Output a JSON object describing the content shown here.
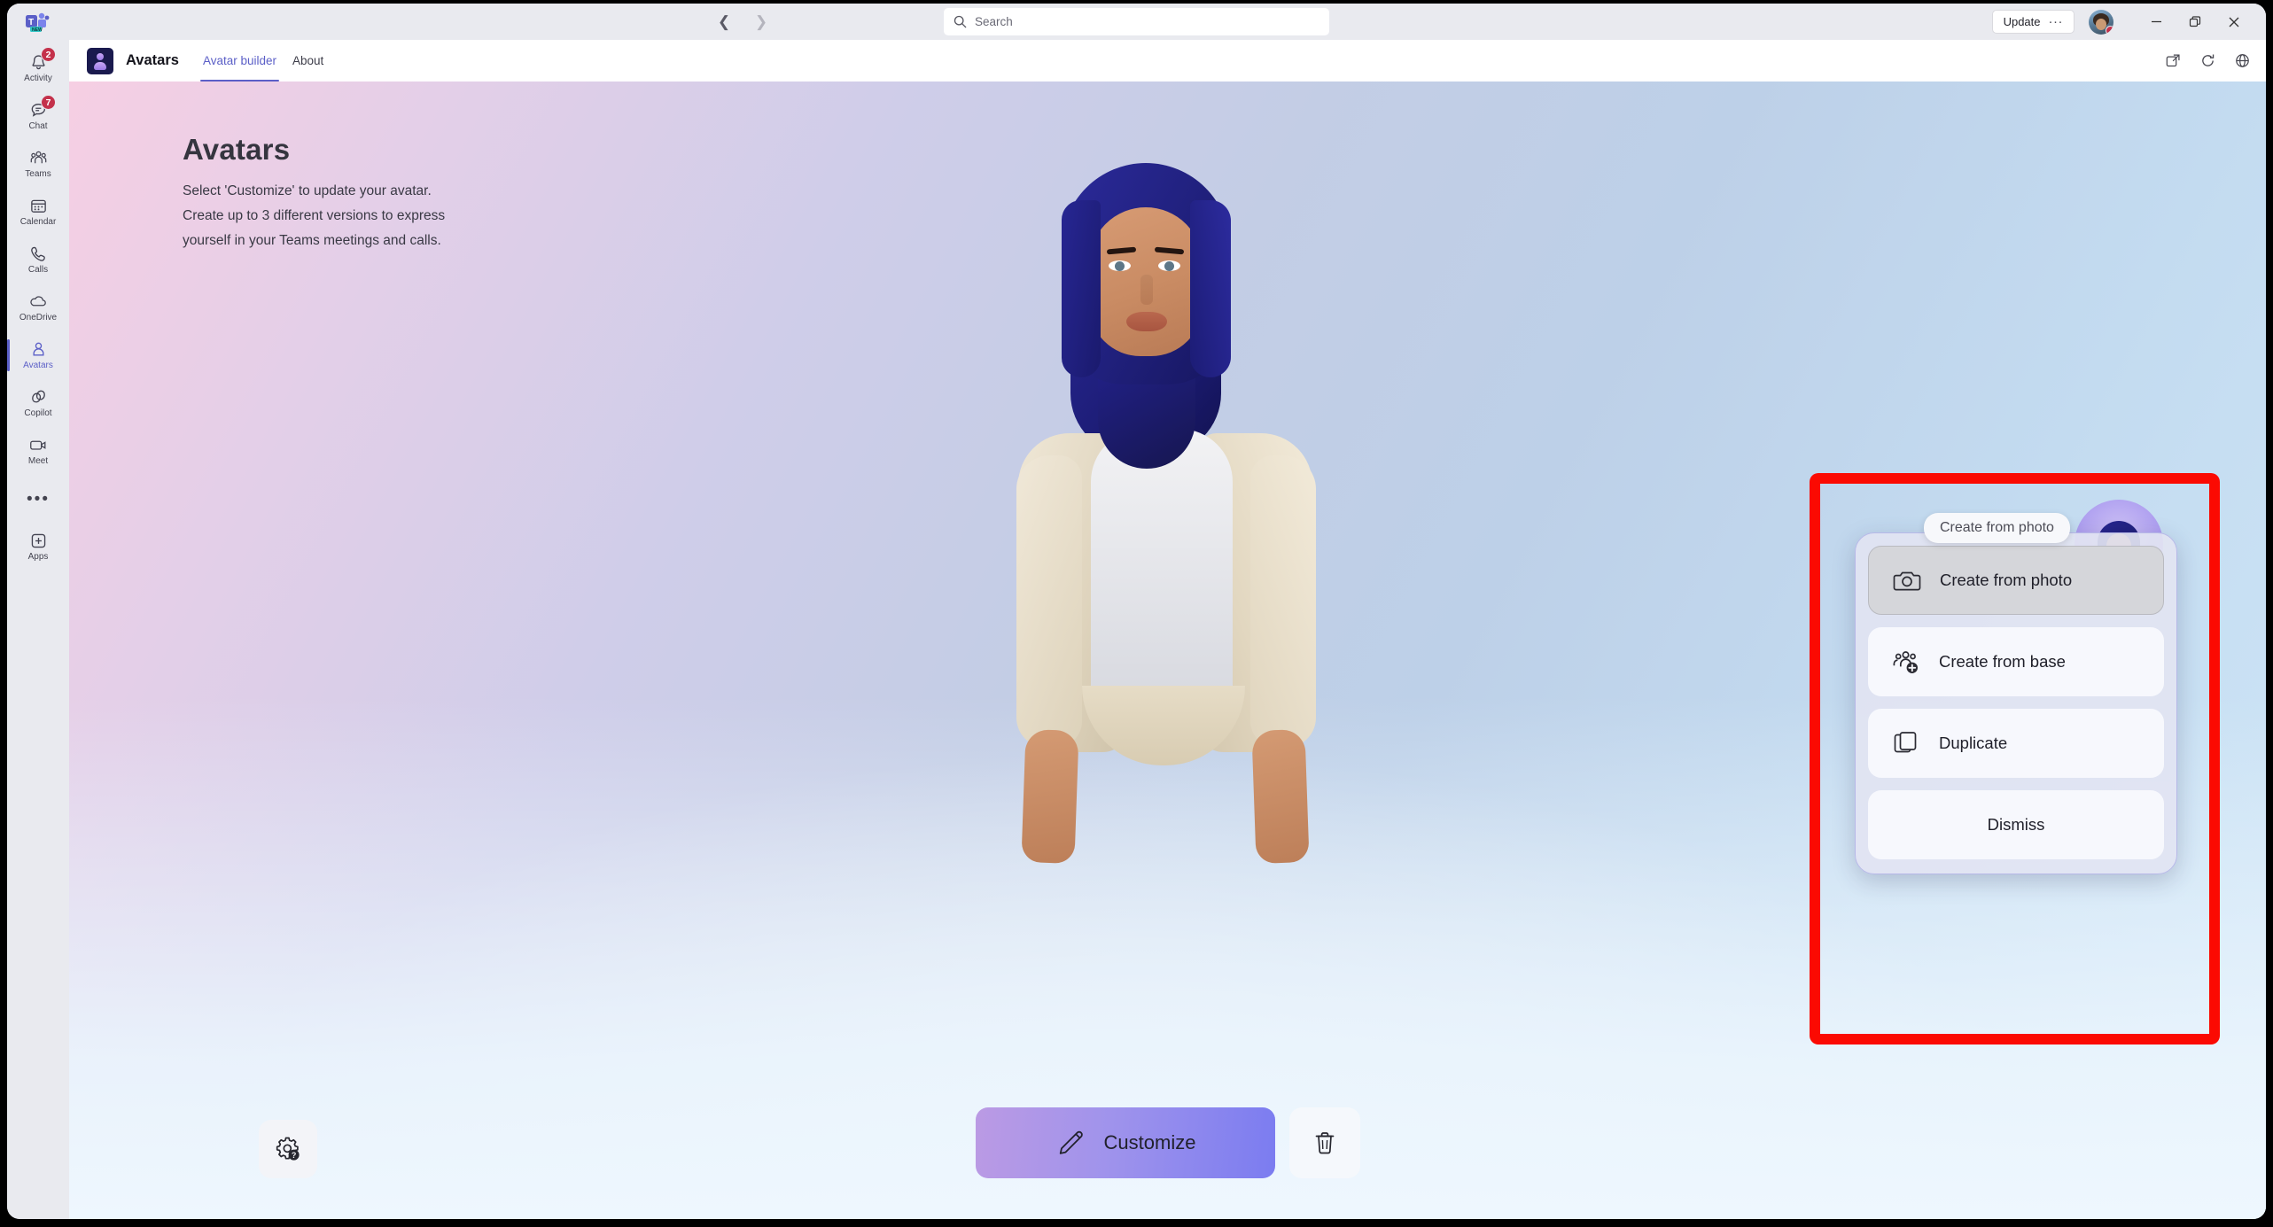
{
  "titlebar": {
    "logo_icon": "teams-logo-icon",
    "back_icon": "chevron-left-icon",
    "forward_icon": "chevron-right-icon",
    "search_placeholder": "Search",
    "search_value": "",
    "search_icon": "search-icon",
    "update_label": "Update",
    "update_overflow": "···",
    "minimize_icon": "minimize-icon",
    "restore_icon": "restore-icon",
    "close_icon": "close-icon",
    "presence": "busy"
  },
  "rail": {
    "items": [
      {
        "label": "Activity",
        "icon": "bell-icon",
        "badge": "2",
        "active": false
      },
      {
        "label": "Chat",
        "icon": "chat-icon",
        "badge": "7",
        "active": false
      },
      {
        "label": "Teams",
        "icon": "teams-people-icon",
        "badge": "",
        "active": false
      },
      {
        "label": "Calendar",
        "icon": "calendar-icon",
        "badge": "",
        "active": false
      },
      {
        "label": "Calls",
        "icon": "phone-icon",
        "badge": "",
        "active": false
      },
      {
        "label": "OneDrive",
        "icon": "cloud-icon",
        "badge": "",
        "active": false
      },
      {
        "label": "Avatars",
        "icon": "person-icon",
        "badge": "",
        "active": true
      },
      {
        "label": "Copilot",
        "icon": "copilot-icon",
        "badge": "",
        "active": false
      },
      {
        "label": "Meet",
        "icon": "video-camera-icon",
        "badge": "",
        "active": false
      }
    ],
    "more_label": "•••",
    "apps_label": "Apps",
    "apps_icon": "plus-square-icon"
  },
  "app_header": {
    "app_icon": "avatars-app-icon",
    "title": "Avatars",
    "tabs": [
      {
        "label": "Avatar builder",
        "active": true
      },
      {
        "label": "About",
        "active": false
      }
    ],
    "actions": [
      {
        "icon": "pop-out-icon"
      },
      {
        "icon": "refresh-icon"
      },
      {
        "icon": "globe-icon"
      }
    ]
  },
  "main": {
    "page_title": "Avatars",
    "description": "Select 'Customize' to update your avatar.\nCreate up to 3 different versions to express\nyourself in your Teams meetings and calls."
  },
  "popup": {
    "tooltip": "Create from photo",
    "items": [
      {
        "label": "Create from photo",
        "icon": "camera-icon",
        "hovered": true
      },
      {
        "label": "Create from base",
        "icon": "people-add-icon",
        "hovered": false
      },
      {
        "label": "Duplicate",
        "icon": "copy-icon",
        "hovered": false
      },
      {
        "label": "Dismiss",
        "icon": "",
        "hovered": false
      }
    ]
  },
  "toolbar": {
    "settings_icon": "gear-help-icon",
    "customize_label": "Customize",
    "customize_icon": "pencil-icon",
    "delete_icon": "trash-icon"
  },
  "colors": {
    "accent": "#5b5fc7",
    "badge": "#c4314b",
    "highlight_box": "#fb0a02",
    "customize_from": "#bb9ae4",
    "customize_to": "#7b7cf0"
  }
}
